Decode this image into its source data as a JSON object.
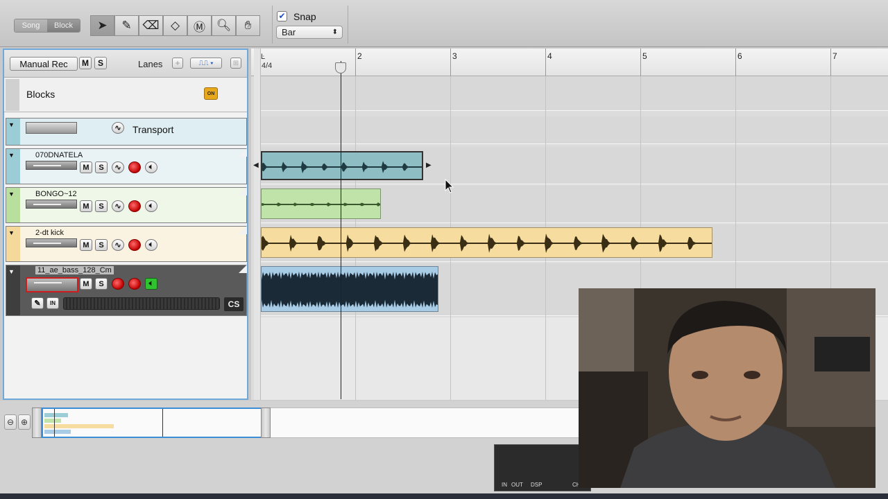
{
  "toolbar": {
    "mode_song": "Song",
    "mode_block": "Block",
    "snap_label": "Snap",
    "snap_checked": true,
    "snap_value": "Bar"
  },
  "track_list": {
    "manual_rec_label": "Manual Rec",
    "mute_label": "M",
    "solo_label": "S",
    "lanes_label": "Lanes",
    "blocks_label": "Blocks",
    "blocks_on_badge": "ON",
    "transport_label": "Transport",
    "tracks": [
      {
        "name": "070DNATELA",
        "color": "#cfe4ea"
      },
      {
        "name": "BONGO~12",
        "color": "#d9efcf"
      },
      {
        "name": "2-dt kick",
        "color": "#f6ead2"
      },
      {
        "name": "11_ae_bass_128_Cm",
        "color": "#4a4a4a"
      }
    ],
    "inspector_in": "IN",
    "inspector_cs": "CS"
  },
  "ruler": {
    "time_signature": "4/4",
    "bars": [
      "2",
      "3",
      "4",
      "5",
      "6",
      "7"
    ]
  },
  "clips": [
    {
      "track": "070DNATELA",
      "color": "#8ebdc4",
      "start_bar": 1,
      "end_bar": 2.7
    },
    {
      "track": "BONGO~12",
      "color": "#bfe3a8",
      "start_bar": 1,
      "end_bar": 2.26
    },
    {
      "track": "2-dt kick",
      "color": "#f6dc9e",
      "start_bar": 1,
      "end_bar": 5.76
    },
    {
      "track": "11_ae_bass_128_Cm",
      "color": "#a8cbe6",
      "start_bar": 1,
      "end_bar": 2.86
    }
  ],
  "transport_mini": {
    "in_label": "IN",
    "out_label": "OUT",
    "dsp_label": "DSP",
    "chl_label": "CHL"
  }
}
